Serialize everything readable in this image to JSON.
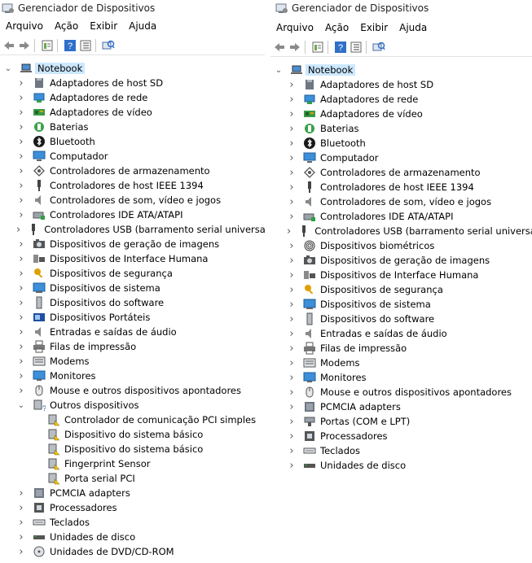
{
  "left": {
    "title": "Gerenciador de Dispositivos",
    "menu": [
      "Arquivo",
      "Ação",
      "Exibir",
      "Ajuda"
    ],
    "root": "Notebook",
    "items": [
      {
        "label": "Adaptadores de host SD",
        "icon": "sd-host-icon",
        "state": "collapsed"
      },
      {
        "label": "Adaptadores de rede",
        "icon": "network-adapter-icon",
        "state": "collapsed"
      },
      {
        "label": "Adaptadores de vídeo",
        "icon": "video-adapter-icon",
        "state": "collapsed"
      },
      {
        "label": "Baterias",
        "icon": "battery-icon",
        "state": "collapsed"
      },
      {
        "label": "Bluetooth",
        "icon": "bluetooth-icon",
        "state": "collapsed"
      },
      {
        "label": "Computador",
        "icon": "computer-icon",
        "state": "collapsed"
      },
      {
        "label": "Controladores de armazenamento",
        "icon": "storage-controller-icon",
        "state": "collapsed"
      },
      {
        "label": "Controladores de host IEEE 1394",
        "icon": "ieee1394-icon",
        "state": "collapsed"
      },
      {
        "label": "Controladores de som, vídeo e jogos",
        "icon": "speaker-icon",
        "state": "collapsed"
      },
      {
        "label": "Controladores IDE ATA/ATAPI",
        "icon": "ide-controller-icon",
        "state": "collapsed"
      },
      {
        "label": "Controladores USB (barramento serial universal)",
        "icon": "usb-icon",
        "state": "collapsed"
      },
      {
        "label": "Dispositivos de geração de imagens",
        "icon": "camera-icon",
        "state": "collapsed"
      },
      {
        "label": "Dispositivos de Interface Humana",
        "icon": "hid-icon",
        "state": "collapsed"
      },
      {
        "label": "Dispositivos de segurança",
        "icon": "security-key-icon",
        "state": "collapsed"
      },
      {
        "label": "Dispositivos de sistema",
        "icon": "system-device-icon",
        "state": "collapsed"
      },
      {
        "label": "Dispositivos do software",
        "icon": "software-device-icon",
        "state": "collapsed"
      },
      {
        "label": "Dispositivos Portáteis",
        "icon": "portable-device-icon",
        "state": "collapsed"
      },
      {
        "label": "Entradas e saídas de áudio",
        "icon": "speaker-icon",
        "state": "collapsed"
      },
      {
        "label": "Filas de impressão",
        "icon": "printer-icon",
        "state": "collapsed"
      },
      {
        "label": "Modems",
        "icon": "modem-icon",
        "state": "collapsed"
      },
      {
        "label": "Monitores",
        "icon": "monitor-icon",
        "state": "collapsed"
      },
      {
        "label": "Mouse e outros dispositivos apontadores",
        "icon": "mouse-icon",
        "state": "collapsed"
      },
      {
        "label": "Outros dispositivos",
        "icon": "unknown-device-icon",
        "state": "expanded"
      },
      {
        "label": "Controlador de comunicação PCI simples",
        "icon": "warning-device-icon",
        "state": "child"
      },
      {
        "label": "Dispositivo do sistema básico",
        "icon": "warning-device-icon",
        "state": "child"
      },
      {
        "label": "Dispositivo do sistema básico",
        "icon": "warning-device-icon",
        "state": "child"
      },
      {
        "label": "Fingerprint Sensor",
        "icon": "warning-device-icon",
        "state": "child"
      },
      {
        "label": "Porta serial PCI",
        "icon": "warning-device-icon",
        "state": "child"
      },
      {
        "label": "PCMCIA adapters",
        "icon": "pcmcia-icon",
        "state": "collapsed"
      },
      {
        "label": "Processadores",
        "icon": "processor-icon",
        "state": "collapsed"
      },
      {
        "label": "Teclados",
        "icon": "keyboard-icon",
        "state": "collapsed"
      },
      {
        "label": "Unidades de disco",
        "icon": "disk-drive-icon",
        "state": "collapsed"
      },
      {
        "label": "Unidades de DVD/CD-ROM",
        "icon": "dvd-drive-icon",
        "state": "collapsed"
      }
    ]
  },
  "right": {
    "title": "Gerenciador de Dispositivos",
    "menu": [
      "Arquivo",
      "Ação",
      "Exibir",
      "Ajuda"
    ],
    "root": "Notebook",
    "items": [
      {
        "label": "Adaptadores de host SD",
        "icon": "sd-host-icon",
        "state": "collapsed"
      },
      {
        "label": "Adaptadores de rede",
        "icon": "network-adapter-icon",
        "state": "collapsed"
      },
      {
        "label": "Adaptadores de vídeo",
        "icon": "video-adapter-icon",
        "state": "collapsed"
      },
      {
        "label": "Baterias",
        "icon": "battery-icon",
        "state": "collapsed"
      },
      {
        "label": "Bluetooth",
        "icon": "bluetooth-icon",
        "state": "collapsed"
      },
      {
        "label": "Computador",
        "icon": "computer-icon",
        "state": "collapsed"
      },
      {
        "label": "Controladores de armazenamento",
        "icon": "storage-controller-icon",
        "state": "collapsed"
      },
      {
        "label": "Controladores de host IEEE 1394",
        "icon": "ieee1394-icon",
        "state": "collapsed"
      },
      {
        "label": "Controladores de som, vídeo e jogos",
        "icon": "speaker-icon",
        "state": "collapsed"
      },
      {
        "label": "Controladores IDE ATA/ATAPI",
        "icon": "ide-controller-icon",
        "state": "collapsed"
      },
      {
        "label": "Controladores USB (barramento serial universal)",
        "icon": "usb-icon",
        "state": "collapsed"
      },
      {
        "label": "Dispositivos biométricos",
        "icon": "fingerprint-icon",
        "state": "collapsed"
      },
      {
        "label": "Dispositivos de geração de imagens",
        "icon": "camera-icon",
        "state": "collapsed"
      },
      {
        "label": "Dispositivos de Interface Humana",
        "icon": "hid-icon",
        "state": "collapsed"
      },
      {
        "label": "Dispositivos de segurança",
        "icon": "security-key-icon",
        "state": "collapsed"
      },
      {
        "label": "Dispositivos de sistema",
        "icon": "system-device-icon",
        "state": "collapsed"
      },
      {
        "label": "Dispositivos do software",
        "icon": "software-device-icon",
        "state": "collapsed"
      },
      {
        "label": "Entradas e saídas de áudio",
        "icon": "speaker-icon",
        "state": "collapsed"
      },
      {
        "label": "Filas de impressão",
        "icon": "printer-icon",
        "state": "collapsed"
      },
      {
        "label": "Modems",
        "icon": "modem-icon",
        "state": "collapsed"
      },
      {
        "label": "Monitores",
        "icon": "monitor-icon",
        "state": "collapsed"
      },
      {
        "label": "Mouse e outros dispositivos apontadores",
        "icon": "mouse-icon",
        "state": "collapsed"
      },
      {
        "label": "PCMCIA adapters",
        "icon": "pcmcia-icon",
        "state": "collapsed"
      },
      {
        "label": "Portas (COM e LPT)",
        "icon": "port-icon",
        "state": "collapsed"
      },
      {
        "label": "Processadores",
        "icon": "processor-icon",
        "state": "collapsed"
      },
      {
        "label": "Teclados",
        "icon": "keyboard-icon",
        "state": "collapsed"
      },
      {
        "label": "Unidades de disco",
        "icon": "disk-drive-icon",
        "state": "collapsed"
      }
    ]
  },
  "colors": {
    "selection": "#cce8ff",
    "chevron": "#555555",
    "separator": "#e3e3e3"
  }
}
